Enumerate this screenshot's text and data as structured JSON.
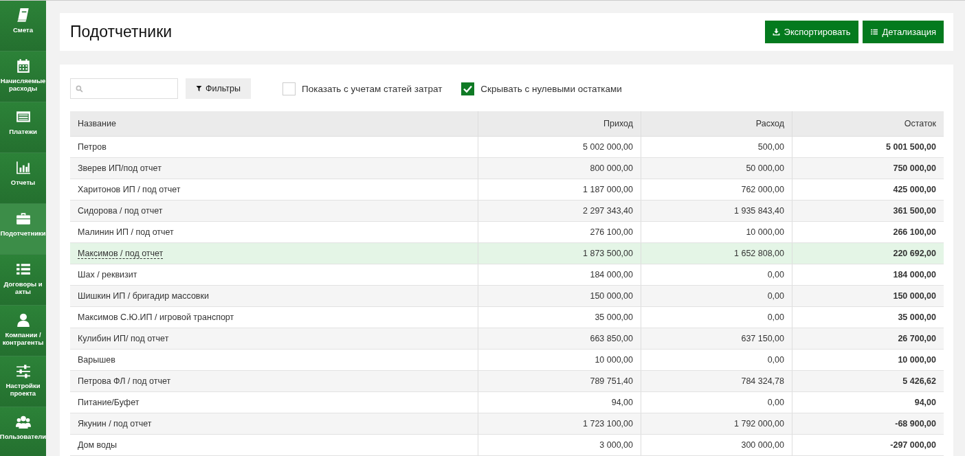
{
  "sidebar": {
    "items": [
      {
        "kind": "book",
        "label": "Смета",
        "selected": false
      },
      {
        "kind": "calendar",
        "label": "Начисляемые расходы",
        "selected": false
      },
      {
        "kind": "card",
        "label": "Платежи",
        "selected": false
      },
      {
        "kind": "chart",
        "label": "Отчеты",
        "selected": false
      },
      {
        "kind": "briefcase",
        "label": "Подотчетники",
        "selected": true
      },
      {
        "kind": "list",
        "label": "Договоры и акты",
        "selected": false
      },
      {
        "kind": "user",
        "label": "Компании / контрагенты",
        "selected": false
      },
      {
        "kind": "sliders",
        "label": "Настройки проекта",
        "selected": false
      },
      {
        "kind": "users",
        "label": "Пользователи",
        "selected": false
      }
    ]
  },
  "header": {
    "title": "Подотчетники",
    "buttons": [
      {
        "kind": "download",
        "label": "Экспортировать"
      },
      {
        "kind": "list",
        "label": "Детализация"
      }
    ]
  },
  "toolbar": {
    "filter_button": "Фильтры",
    "checkboxes": [
      {
        "label": "Показать с учетам статей затрат",
        "checked": false
      },
      {
        "label": "Скрывать с нулевыми остатками",
        "checked": true
      }
    ]
  },
  "table": {
    "columns": [
      "Название",
      "Приход",
      "Расход",
      "Остаток"
    ],
    "rows": [
      {
        "cells": [
          "Петров",
          "5 002 000,00",
          "500,00",
          "5 001 500,00"
        ],
        "selected": false
      },
      {
        "cells": [
          "Зверев ИП/под отчет",
          "800 000,00",
          "50 000,00",
          "750 000,00"
        ],
        "selected": false
      },
      {
        "cells": [
          "Харитонов ИП / под отчет",
          "1 187 000,00",
          "762 000,00",
          "425 000,00"
        ],
        "selected": false
      },
      {
        "cells": [
          "Сидорова / под отчет",
          "2 297 343,40",
          "1 935 843,40",
          "361 500,00"
        ],
        "selected": false
      },
      {
        "cells": [
          "Малинин ИП / под отчет",
          "276 100,00",
          "10 000,00",
          "266 100,00"
        ],
        "selected": false
      },
      {
        "cells": [
          "Максимов / под отчет",
          "1 873 500,00",
          "1 652 808,00",
          "220 692,00"
        ],
        "selected": true
      },
      {
        "cells": [
          "Шах / реквизит",
          "184 000,00",
          "0,00",
          "184 000,00"
        ],
        "selected": false
      },
      {
        "cells": [
          "Шишкин ИП / бригадир массовки",
          "150 000,00",
          "0,00",
          "150 000,00"
        ],
        "selected": false
      },
      {
        "cells": [
          "Максимов С.Ю.ИП / игровой транспорт",
          "35 000,00",
          "0,00",
          "35 000,00"
        ],
        "selected": false
      },
      {
        "cells": [
          "Кулибин ИП/ под отчет",
          "663 850,00",
          "637 150,00",
          "26 700,00"
        ],
        "selected": false
      },
      {
        "cells": [
          "Варышев",
          "10 000,00",
          "0,00",
          "10 000,00"
        ],
        "selected": false
      },
      {
        "cells": [
          "Петрова ФЛ / под отчет",
          "789 751,40",
          "784 324,78",
          "5 426,62"
        ],
        "selected": false
      },
      {
        "cells": [
          "Питание/Буфет",
          "94,00",
          "0,00",
          "94,00"
        ],
        "selected": false
      },
      {
        "cells": [
          "Якунин / под отчет",
          "1 723 100,00",
          "1 792 000,00",
          "-68 900,00"
        ],
        "selected": false
      },
      {
        "cells": [
          "Дом воды",
          "3 000,00",
          "300 000,00",
          "-297 000,00"
        ],
        "selected": false
      }
    ]
  }
}
